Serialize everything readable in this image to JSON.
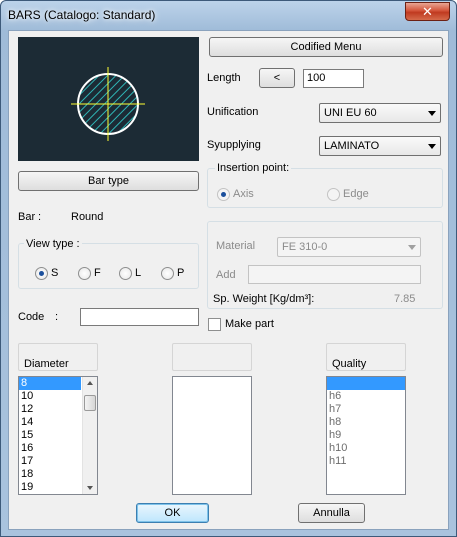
{
  "window": {
    "title": "BARS (Catalogo: Standard)",
    "close_glyph": "✕"
  },
  "buttons": {
    "codified_menu": "Codified Menu",
    "length_dec": "<",
    "bar_type": "Bar type",
    "ok": "OK",
    "cancel": "Annulla"
  },
  "length": {
    "label": "Length",
    "value": "100"
  },
  "unification": {
    "label": "Unification",
    "value": "UNI EU 60"
  },
  "supplying": {
    "label": "Syupplying",
    "value": "LAMINATO"
  },
  "insertion": {
    "label": "Insertion point:",
    "axis": "Axis",
    "edge": "Edge"
  },
  "bar": {
    "label": "Bar",
    "sep": ":",
    "value": "Round"
  },
  "view_type": {
    "label": "View type  :",
    "options": [
      "S",
      "F",
      "L",
      "P"
    ],
    "selected": "S"
  },
  "code": {
    "label": "Code",
    "sep": ":",
    "value": ""
  },
  "material": {
    "label": "Material",
    "value": "FE 310-0",
    "add_label": "Add",
    "add_value": "",
    "weight_label": "Sp. Weight [Kg/dm³]:",
    "weight_value": "7.85"
  },
  "make_part": {
    "label": "Make part",
    "checked": false
  },
  "diameter": {
    "header": "Diameter",
    "items": [
      "8",
      "10",
      "12",
      "14",
      "15",
      "16",
      "17",
      "18",
      "19"
    ],
    "selected": "8"
  },
  "middle_list": {
    "header": "",
    "items": []
  },
  "quality": {
    "header": "Quality",
    "items": [
      "",
      "h6",
      "h7",
      "h8",
      "h9",
      "h10",
      "h11"
    ],
    "selected_index": 0
  },
  "colors": {
    "preview_bg": "#1c2b35",
    "circle": "#ffffff",
    "hatch": "#2fb7b7",
    "crosshair": "#ffff33",
    "selection": "#3399ff"
  }
}
